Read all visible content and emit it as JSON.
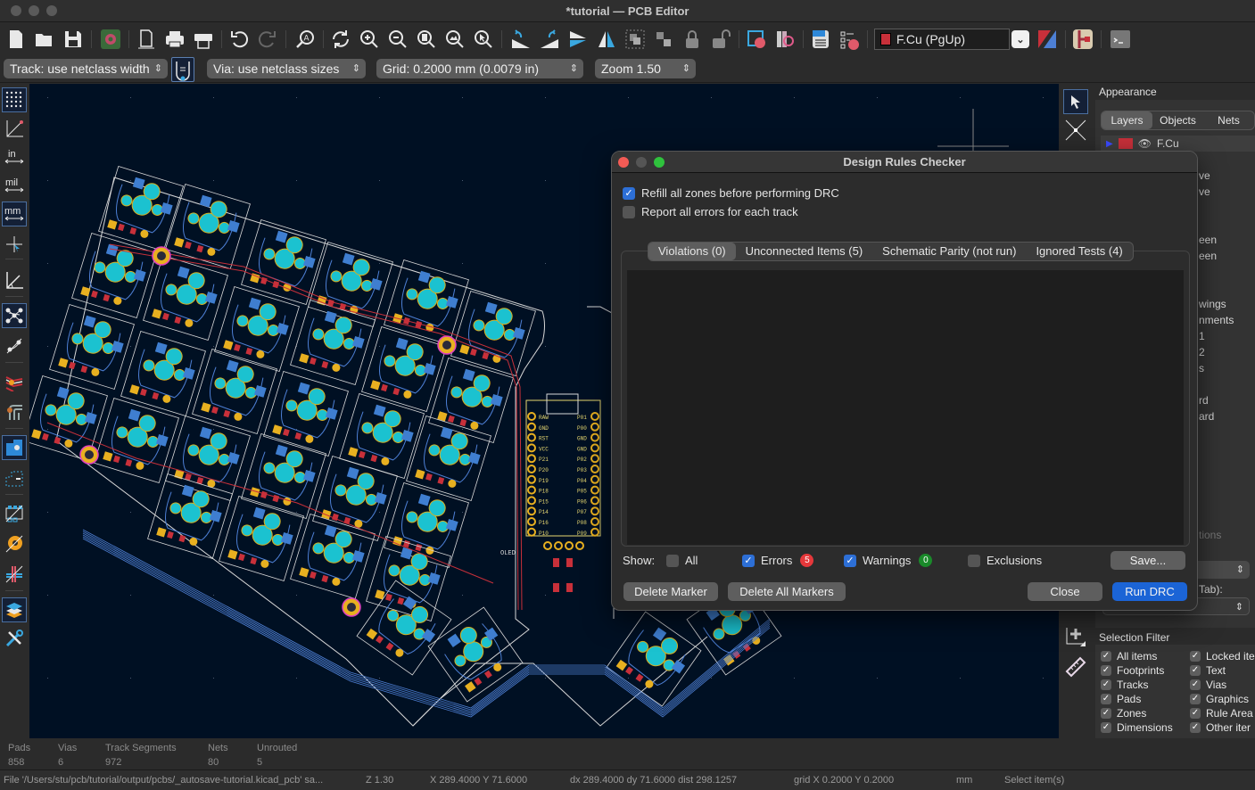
{
  "window": {
    "title": "*tutorial — PCB Editor"
  },
  "toolbar": {
    "icons": [
      "new-board-icon",
      "open-icon",
      "save-icon",
      "board-setup-icon",
      "page-settings-icon",
      "print-icon",
      "plot-icon",
      "undo-icon",
      "redo-icon",
      "find-icon",
      "redraw-icon",
      "zoom-in-icon",
      "zoom-out-icon",
      "zoom-fit-icon",
      "zoom-objects-icon",
      "zoom-selection-icon",
      "rotate-ccw-icon",
      "rotate-cw-icon",
      "mirror-vertical-icon",
      "mirror-horizontal-icon",
      "group-icon",
      "ungroup-icon",
      "lock-icon",
      "unlock-icon",
      "footprint-editor-icon",
      "footprint-browser-icon",
      "netlist-icon",
      "drc-icon"
    ],
    "active_layer": "F.Cu (PgUp)",
    "active_layer_color": "#c8303a",
    "right_icons": [
      "layer-pair-icon",
      "scripting-icon",
      "console-icon"
    ]
  },
  "toolbar2": {
    "track_width": "Track: use netclass width",
    "via_size": "Via: use netclass sizes",
    "grid": "Grid: 0.2000 mm (0.0079 in)",
    "zoom": "Zoom 1.50"
  },
  "left_toolbar": [
    "grid-icon",
    "polar-coords-icon",
    "inches-icon",
    "mils-icon",
    "millimeters-icon",
    "cursor-crosshair-icon",
    "angle-snap-icon",
    "ratsnest-icon",
    "curved-ratsnest-icon",
    "high-contrast-icon",
    "net-colors-icon",
    "zone-fill-icon",
    "zone-outline-icon",
    "footprint-icon",
    "via-icon",
    "track-icon",
    "layers-manager-icon",
    "properties-icon"
  ],
  "left_toolbar_labels": {
    "inches": "in",
    "mils": "mil",
    "mm": "mm"
  },
  "right_toolbar": [
    "select-icon",
    "local-ratsnest-icon",
    "grid-origin-icon",
    "measure-icon"
  ],
  "appearance": {
    "title": "Appearance",
    "tabs": [
      "Layers",
      "Objects",
      "Nets"
    ],
    "active_tab": "Layers",
    "first_layer": "F.Cu",
    "partial_rows": [
      "ve",
      "ve",
      "een",
      "een",
      "wings",
      "nments",
      "1",
      "2",
      "s",
      "rd",
      "ard"
    ],
    "partial_options": "tions",
    "partial_tab_label": "Tab):"
  },
  "selection_filter": {
    "title": "Selection Filter",
    "items_left": [
      "All items",
      "Footprints",
      "Tracks",
      "Pads",
      "Zones",
      "Dimensions"
    ],
    "items_right": [
      "Locked ite",
      "Text",
      "Vias",
      "Graphics",
      "Rule Area",
      "Other iter"
    ]
  },
  "status": {
    "labels": [
      "Pads",
      "Vias",
      "Track Segments",
      "Nets",
      "Unrouted"
    ],
    "values": [
      "858",
      "6",
      "972",
      "80",
      "5"
    ]
  },
  "messages": {
    "file": "File '/Users/stu/pcb/tutorial/output/pcbs/_autosave-tutorial.kicad_pcb' sa...",
    "zoom": "Z 1.30",
    "coords": "X 289.4000  Y 71.6000",
    "delta": "dx 289.4000  dy 71.6000  dist 298.1257",
    "grid": "grid X 0.2000  Y 0.2000",
    "units": "mm",
    "action": "Select item(s)"
  },
  "drc": {
    "title": "Design Rules Checker",
    "refill_zones": {
      "label": "Refill all zones before performing DRC",
      "checked": true
    },
    "report_all": {
      "label": "Report all errors for each track",
      "checked": false
    },
    "tabs": [
      "Violations (0)",
      "Unconnected Items (5)",
      "Schematic Parity (not run)",
      "Ignored Tests (4)"
    ],
    "active_tab": "Violations (0)",
    "show_label": "Show:",
    "filters": {
      "all": {
        "label": "All",
        "checked": false
      },
      "errors": {
        "label": "Errors",
        "checked": true,
        "count": "5"
      },
      "warnings": {
        "label": "Warnings",
        "checked": true,
        "count": "0"
      },
      "exclusions": {
        "label": "Exclusions",
        "checked": false
      }
    },
    "buttons": {
      "save": "Save...",
      "delete_marker": "Delete Marker",
      "delete_all": "Delete All Markers",
      "close": "Close",
      "run": "Run DRC"
    },
    "colors": {
      "error_badge": "#e5383b",
      "warning_badge": "#1a8a2a",
      "primary": "#1b64d6"
    }
  },
  "pcb": {
    "silkscreen_label": "OLED",
    "mcu_left_pins": [
      "RAW",
      "GND",
      "RST",
      "VCC",
      "P21",
      "P20",
      "P19",
      "P18",
      "P15",
      "P14",
      "P16",
      "P10"
    ],
    "mcu_right_pins": [
      "P01",
      "P00",
      "GND",
      "GND",
      "P02",
      "P03",
      "P04",
      "P05",
      "P06",
      "P07",
      "P08",
      "P09"
    ],
    "colors": {
      "background": "#001023",
      "pad": "#1bc2d0",
      "smd": "#3f7ed0",
      "track_front": "#c8303a",
      "track_back": "#4d7fd4",
      "outline": "#d8d8d8",
      "silk": "#e8c33a"
    }
  }
}
